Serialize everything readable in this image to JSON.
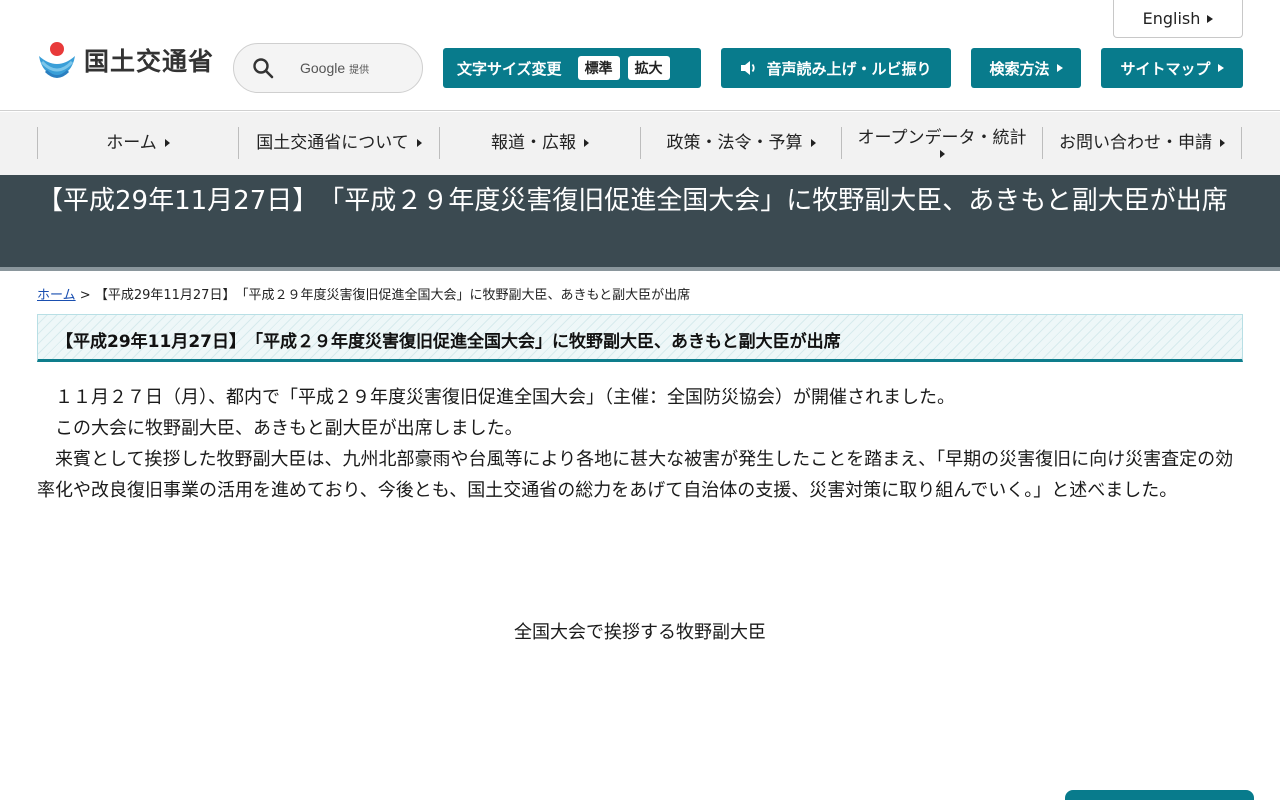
{
  "header": {
    "logo_text": "国土交通省",
    "search": {
      "provider": "Google",
      "provider_suffix": "提供"
    },
    "english_label": "English",
    "font_size": {
      "label": "文字サイズ変更",
      "standard": "標準",
      "large": "拡大"
    },
    "voice_label": "音声読み上げ・ルビ振り",
    "search_method_label": "検索方法",
    "sitemap_label": "サイトマップ"
  },
  "nav": {
    "items": [
      {
        "label": "ホーム"
      },
      {
        "label": "国土交通省について"
      },
      {
        "label": "報道・広報"
      },
      {
        "label": "政策・法令・予算"
      },
      {
        "label": "オープンデータ・統計"
      },
      {
        "label": "お問い合わせ・申請"
      }
    ]
  },
  "page": {
    "title": "【平成29年11月27日】　「平成２９年度災害復旧促進全国大会」に牧野副大臣、あきもと副大臣が出席"
  },
  "breadcrumb": {
    "home": "ホーム",
    "separator": ">",
    "current": "【平成29年11月27日】　「平成２９年度災害復旧促進全国大会」に牧野副大臣、あきもと副大臣が出席"
  },
  "article": {
    "heading": "【平成29年11月27日】　「平成２９年度災害復旧促進全国大会」に牧野副大臣、あきもと副大臣が出席",
    "paragraphs": [
      "１１月２７日（月）、都内で「平成２９年度災害復旧促進全国大会」（主催：全国防災協会）が開催されました。",
      "この大会に牧野副大臣、あきもと副大臣が出席しました。",
      "来賓として挨拶した牧野副大臣は、九州北部豪雨や台風等により各地に甚大な被害が発生したことを踏まえ、「早期の災害復旧に向け災害査定の効率化や改良復旧事業の活用を進めており、今後とも、国土交通省の総力をあげて自治体の支援、災害対策に取り組んでいく。」と述べました。"
    ],
    "photo_caption": "全国大会で挨拶する牧野副大臣"
  },
  "colors": {
    "accent": "#087b8c",
    "title_band": "#3b4a51",
    "nav_bg": "#f2f2f2"
  }
}
